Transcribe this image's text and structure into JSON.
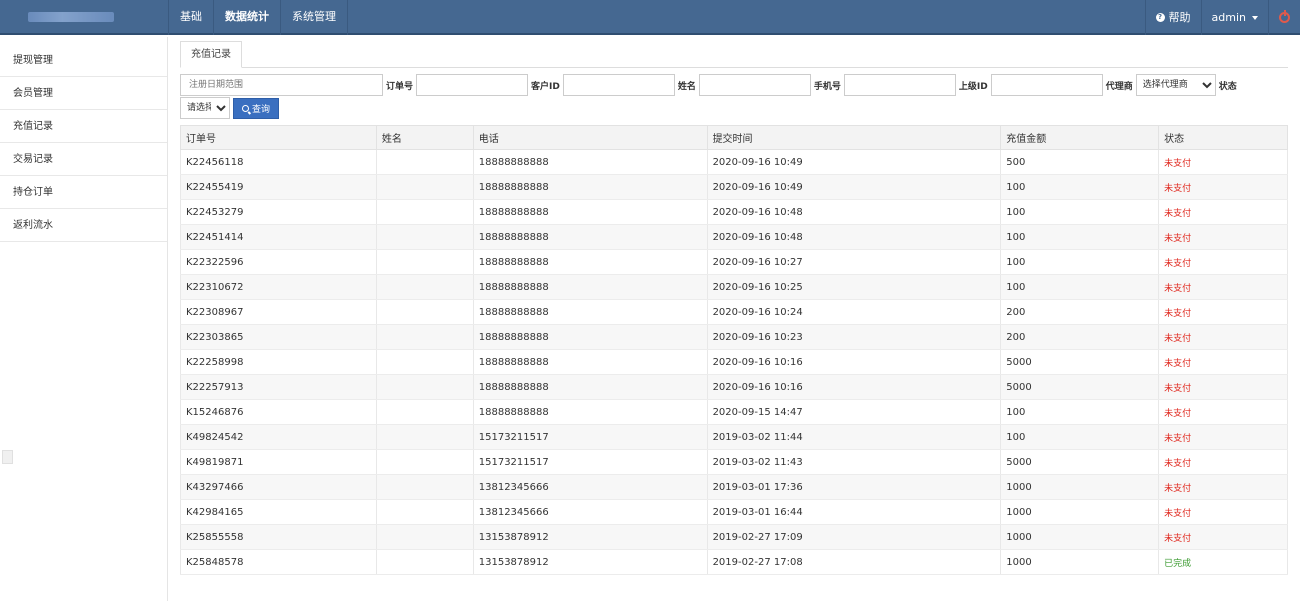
{
  "nav": {
    "items": [
      "基础",
      "数据统计",
      "系统管理"
    ],
    "help": "帮助",
    "user": "admin"
  },
  "sidebar": {
    "items": [
      "提现管理",
      "会员管理",
      "充值记录",
      "交易记录",
      "持仓订单",
      "返利流水"
    ]
  },
  "tab": {
    "label": "充值记录"
  },
  "filters": {
    "date_placeholder": "注册日期范围",
    "order_label": "订单号",
    "customer_label": "客户ID",
    "name_label": "姓名",
    "phone_label": "手机号",
    "parent_label": "上级ID",
    "agent_label": "代理商",
    "agent_select": "选择代理商",
    "status_label": "状态",
    "status_select": "请选择",
    "search_button": "查询"
  },
  "table": {
    "headers": [
      "订单号",
      "姓名",
      "电话",
      "提交时间",
      "充值金额",
      "状态"
    ],
    "rows": [
      {
        "order": "K22456118",
        "name": "",
        "phone": "18888888888",
        "time": "2020-09-16 10:49",
        "amount": "500",
        "status": "未支付"
      },
      {
        "order": "K22455419",
        "name": "",
        "phone": "18888888888",
        "time": "2020-09-16 10:49",
        "amount": "100",
        "status": "未支付"
      },
      {
        "order": "K22453279",
        "name": "",
        "phone": "18888888888",
        "time": "2020-09-16 10:48",
        "amount": "100",
        "status": "未支付"
      },
      {
        "order": "K22451414",
        "name": "",
        "phone": "18888888888",
        "time": "2020-09-16 10:48",
        "amount": "100",
        "status": "未支付"
      },
      {
        "order": "K22322596",
        "name": "",
        "phone": "18888888888",
        "time": "2020-09-16 10:27",
        "amount": "100",
        "status": "未支付"
      },
      {
        "order": "K22310672",
        "name": "",
        "phone": "18888888888",
        "time": "2020-09-16 10:25",
        "amount": "100",
        "status": "未支付"
      },
      {
        "order": "K22308967",
        "name": "",
        "phone": "18888888888",
        "time": "2020-09-16 10:24",
        "amount": "200",
        "status": "未支付"
      },
      {
        "order": "K22303865",
        "name": "",
        "phone": "18888888888",
        "time": "2020-09-16 10:23",
        "amount": "200",
        "status": "未支付"
      },
      {
        "order": "K22258998",
        "name": "",
        "phone": "18888888888",
        "time": "2020-09-16 10:16",
        "amount": "5000",
        "status": "未支付"
      },
      {
        "order": "K22257913",
        "name": "",
        "phone": "18888888888",
        "time": "2020-09-16 10:16",
        "amount": "5000",
        "status": "未支付"
      },
      {
        "order": "K15246876",
        "name": "",
        "phone": "18888888888",
        "time": "2020-09-15 14:47",
        "amount": "100",
        "status": "未支付"
      },
      {
        "order": "K49824542",
        "name": "",
        "phone": "15173211517",
        "time": "2019-03-02 11:44",
        "amount": "100",
        "status": "未支付"
      },
      {
        "order": "K49819871",
        "name": "",
        "phone": "15173211517",
        "time": "2019-03-02 11:43",
        "amount": "5000",
        "status": "未支付"
      },
      {
        "order": "K43297466",
        "name": "",
        "phone": "13812345666",
        "time": "2019-03-01 17:36",
        "amount": "1000",
        "status": "未支付"
      },
      {
        "order": "K42984165",
        "name": "",
        "phone": "13812345666",
        "time": "2019-03-01 16:44",
        "amount": "1000",
        "status": "未支付"
      },
      {
        "order": "K25855558",
        "name": "",
        "phone": "13153878912",
        "time": "2019-02-27 17:09",
        "amount": "1000",
        "status": "未支付"
      },
      {
        "order": "K25848578",
        "name": "",
        "phone": "13153878912",
        "time": "2019-02-27 17:08",
        "amount": "1000",
        "status": "已完成"
      }
    ]
  },
  "colors": {
    "navbar": "#456891",
    "unpaid": "#e0261c",
    "done": "#3a9a2f",
    "primary_button": "#3a6fc0"
  }
}
